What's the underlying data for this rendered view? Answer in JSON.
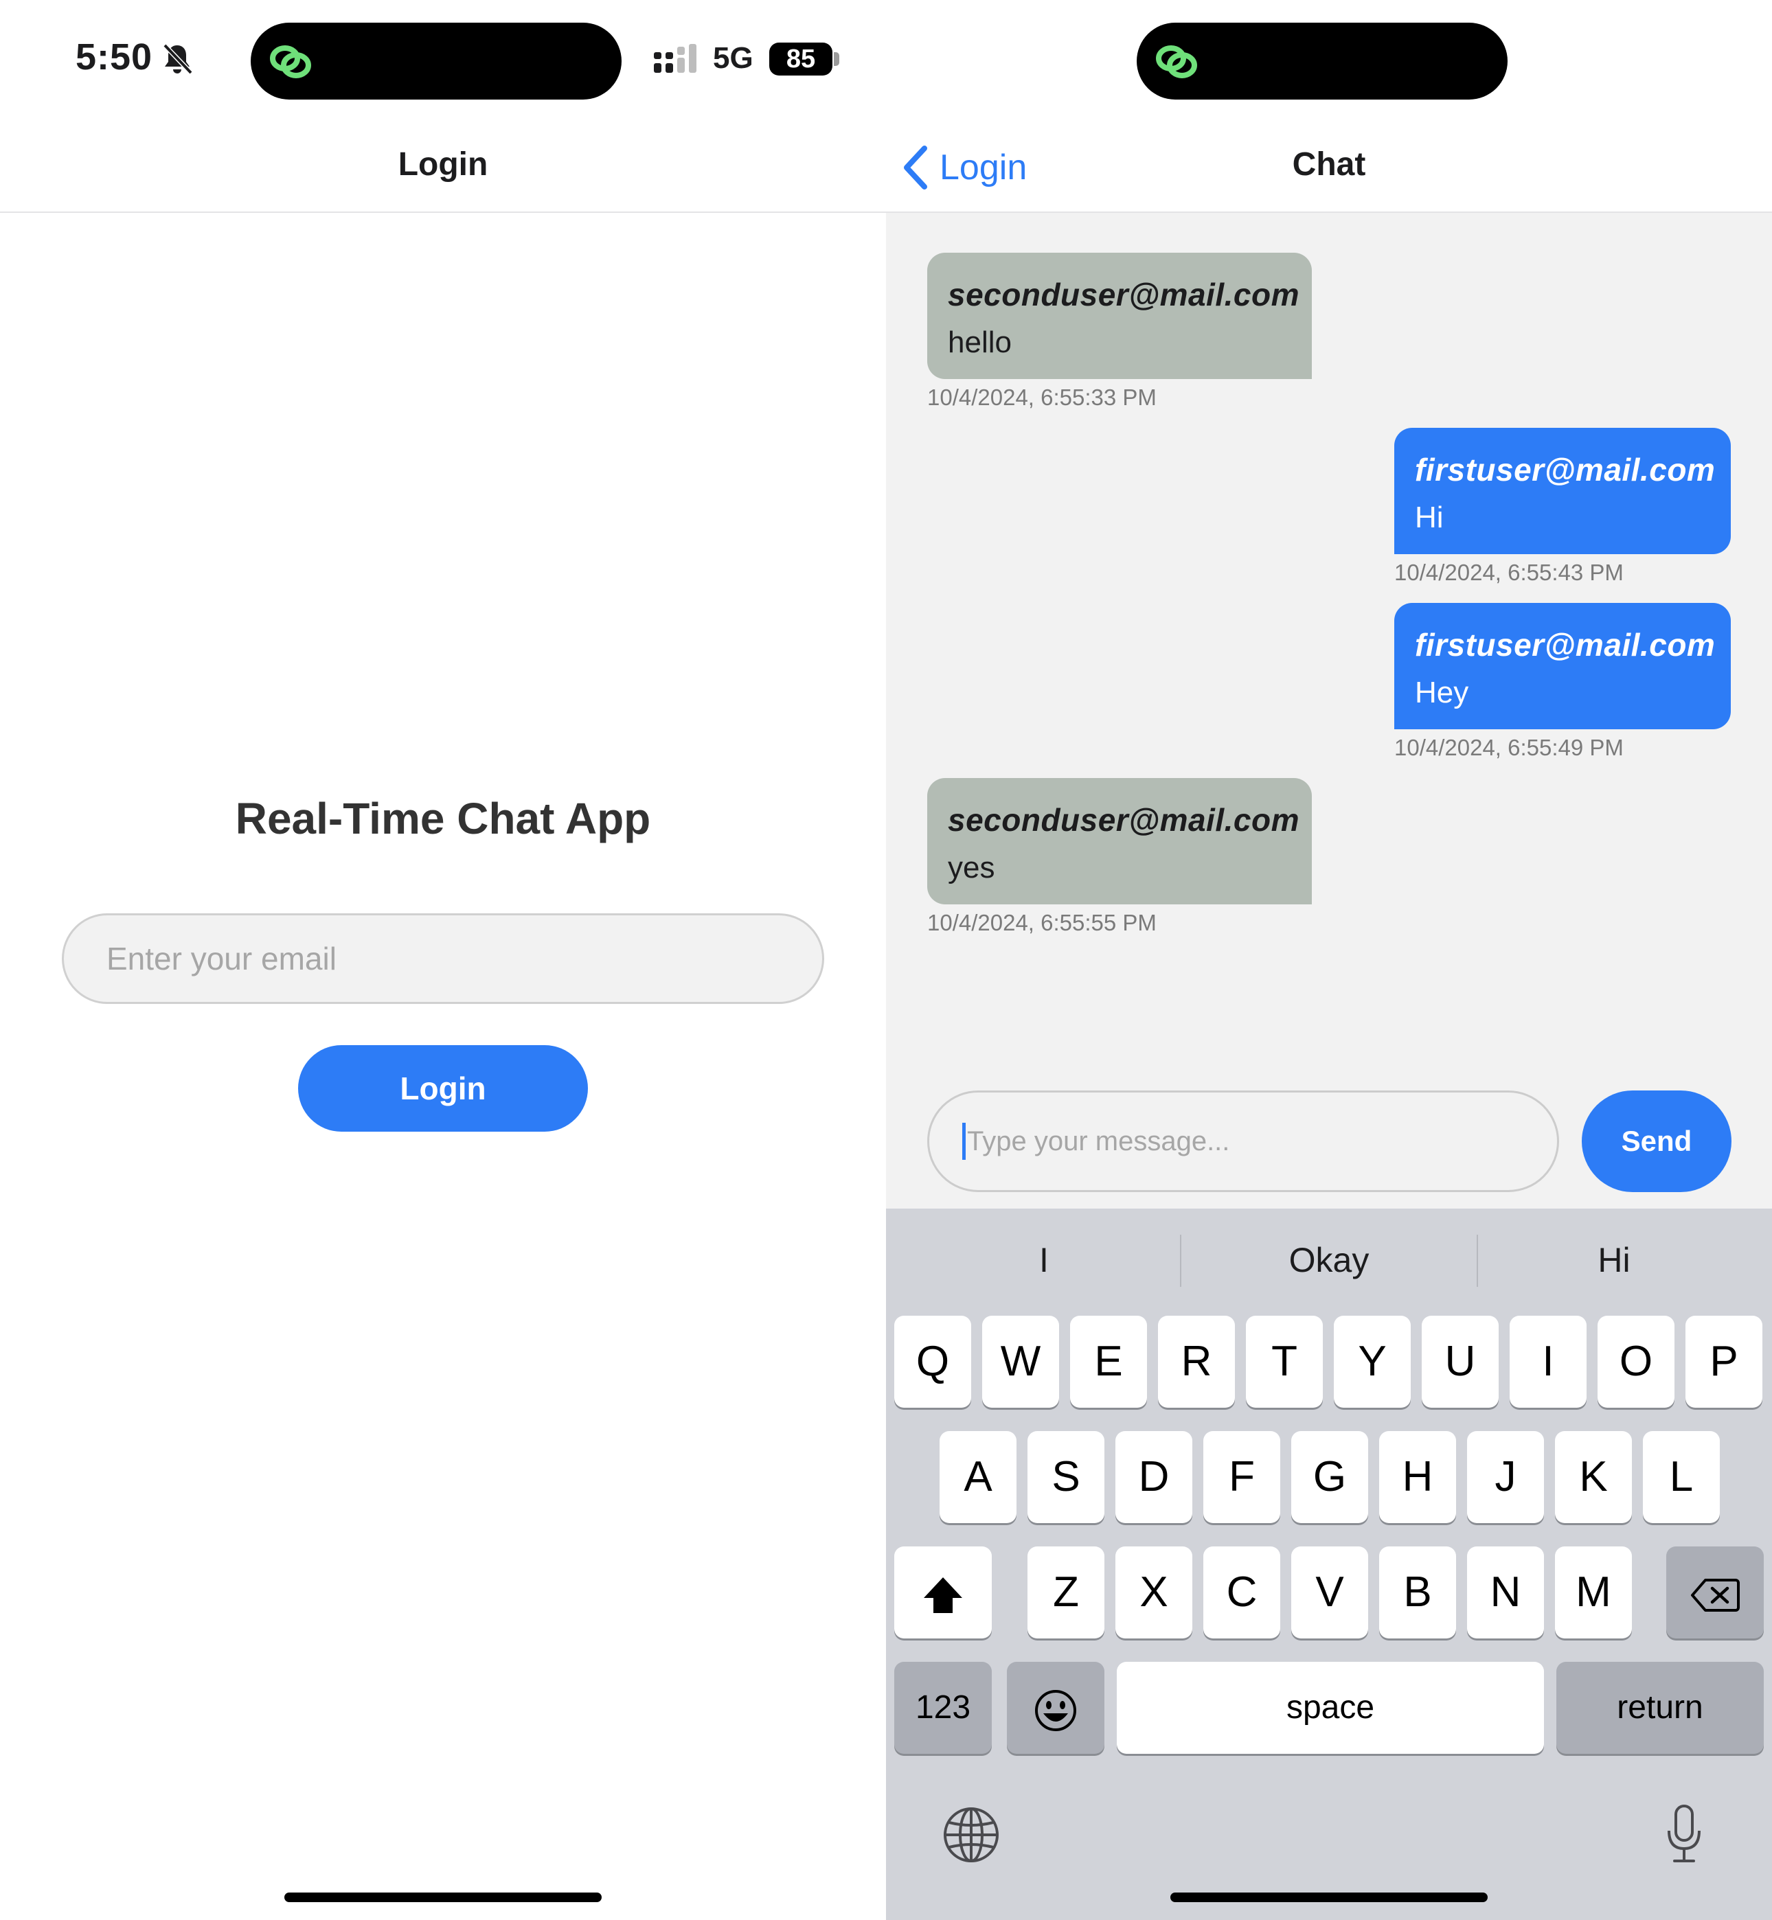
{
  "status_bar": {
    "time": "5:50",
    "network": "5G",
    "battery": "85"
  },
  "login_screen": {
    "nav_title": "Login",
    "app_title": "Real-Time Chat App",
    "email_placeholder": "Enter your email",
    "login_button": "Login"
  },
  "chat_screen": {
    "back_label": "Login",
    "nav_title": "Chat",
    "messages": [
      {
        "sender": "seconduser@mail.com",
        "text": "hello",
        "timestamp": "10/4/2024, 6:55:33 PM",
        "side": "left"
      },
      {
        "sender": "firstuser@mail.com",
        "text": "Hi",
        "timestamp": "10/4/2024, 6:55:43 PM",
        "side": "right"
      },
      {
        "sender": "firstuser@mail.com",
        "text": "Hey",
        "timestamp": "10/4/2024, 6:55:49 PM",
        "side": "right"
      },
      {
        "sender": "seconduser@mail.com",
        "text": "yes",
        "timestamp": "10/4/2024, 6:55:55 PM",
        "side": "left"
      }
    ],
    "message_placeholder": "Type your message...",
    "send_button": "Send"
  },
  "keyboard": {
    "suggestions": [
      "I",
      "Okay",
      "Hi"
    ],
    "row1": [
      "Q",
      "W",
      "E",
      "R",
      "T",
      "Y",
      "U",
      "I",
      "O",
      "P"
    ],
    "row2": [
      "A",
      "S",
      "D",
      "F",
      "G",
      "H",
      "J",
      "K",
      "L"
    ],
    "row3": [
      "Z",
      "X",
      "C",
      "V",
      "B",
      "N",
      "M"
    ],
    "numbers_key": "123",
    "space_key": "space",
    "return_key": "return"
  },
  "colors": {
    "accent": "#2d7cf6",
    "received_bubble": "#b3bcb4",
    "chat_background": "#f2f2f2",
    "keyboard_background": "#d1d3d9"
  }
}
